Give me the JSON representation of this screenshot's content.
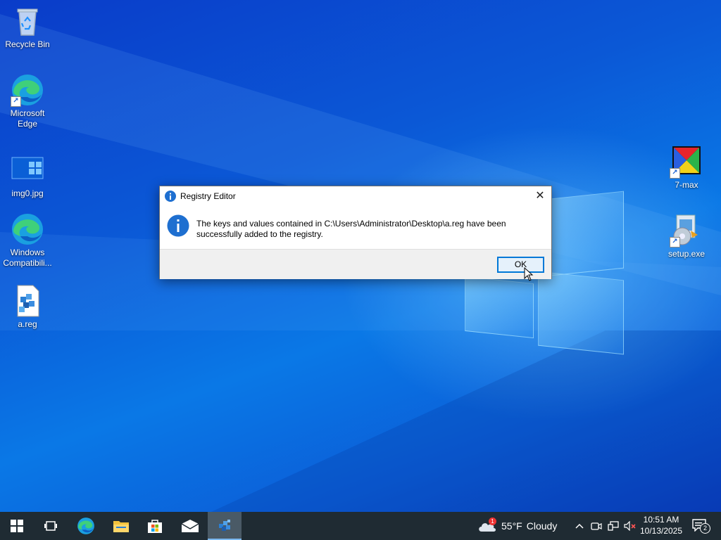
{
  "desktop": {
    "icons_left": [
      {
        "label": "Recycle Bin",
        "icon": "recycle-bin-icon"
      },
      {
        "label": "Microsoft Edge",
        "icon": "edge-icon"
      },
      {
        "label": "img0.jpg",
        "icon": "image-file-icon"
      },
      {
        "label": "Windows Compatibili...",
        "icon": "edge-icon"
      },
      {
        "label": "a.reg",
        "icon": "registry-file-icon"
      }
    ],
    "icons_right": [
      {
        "label": "7-max",
        "icon": "seven-max-icon"
      },
      {
        "label": "setup.exe",
        "icon": "setup-exe-icon"
      }
    ]
  },
  "dialog": {
    "title": "Registry Editor",
    "message": "The keys and values contained in C:\\Users\\Administrator\\Desktop\\a.reg have been successfully added to the registry.",
    "ok_label": "OK",
    "close_glyph": "✕"
  },
  "taskbar": {
    "weather_temp": "55°F",
    "weather_condition": "Cloudy",
    "weather_badge": "1",
    "time": "10:51 AM",
    "date": "10/13/2025",
    "notification_count": "2"
  },
  "colors": {
    "accent": "#0078d7",
    "taskbar": "#1f2b33",
    "desktop": "#0b58d6"
  }
}
